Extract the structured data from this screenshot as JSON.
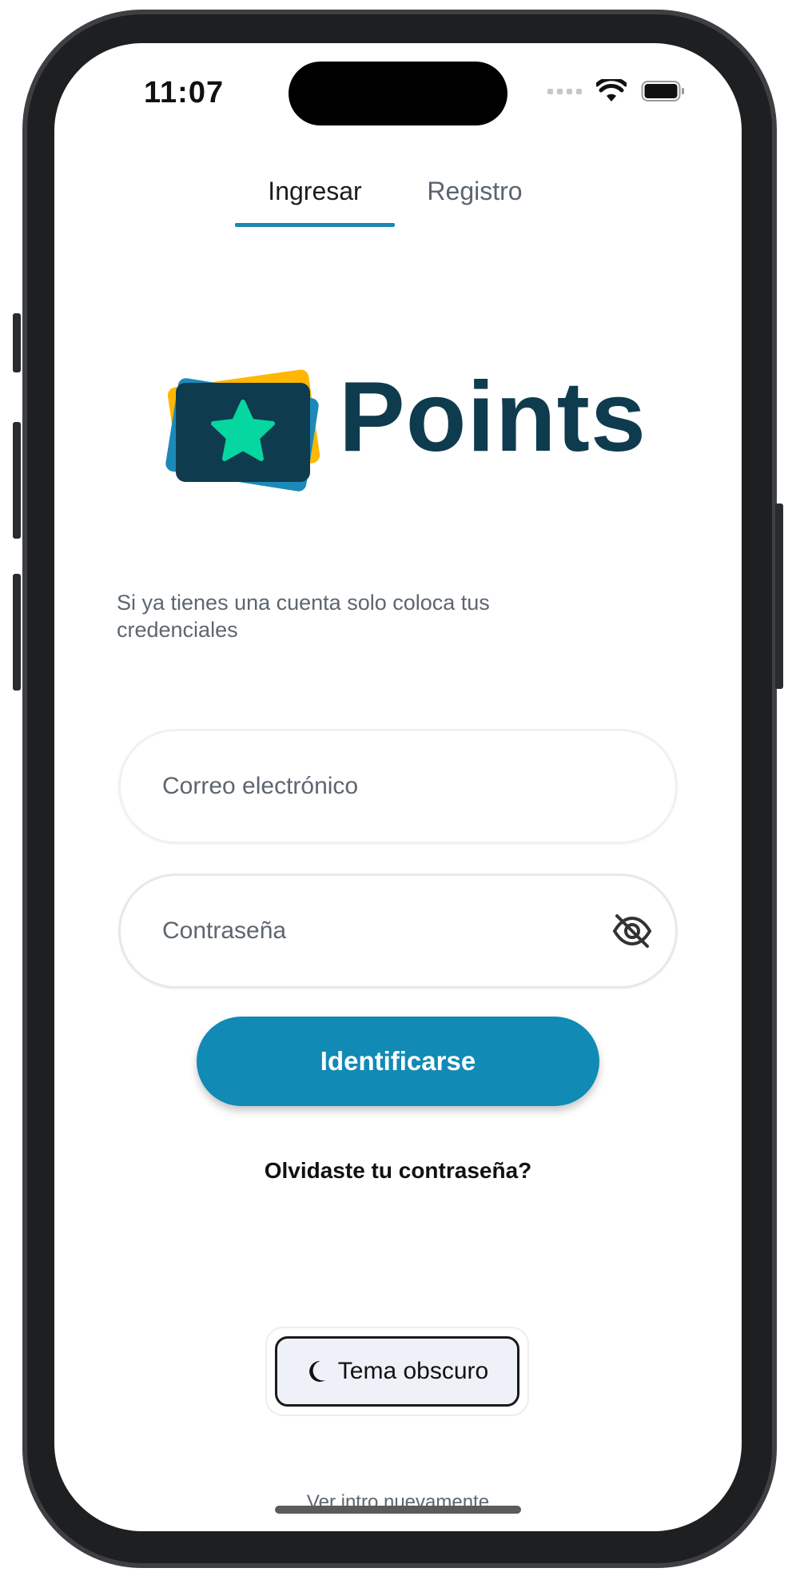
{
  "status_bar": {
    "time": "11:07",
    "icons": [
      "signal-icon",
      "wifi-icon",
      "battery-icon"
    ]
  },
  "tabs": [
    {
      "label": "Ingresar",
      "active": true
    },
    {
      "label": "Registro",
      "active": false
    }
  ],
  "logo": {
    "text": "Points",
    "icon": "star-card-logo-icon"
  },
  "intro_text": "Si ya tienes una cuenta solo coloca tus credenciales",
  "form": {
    "email_placeholder": "Correo electrónico",
    "email_value": "",
    "password_placeholder": "Contraseña",
    "password_value": "",
    "password_toggle_icon": "eye-off-icon",
    "submit_label": "Identificarse",
    "forgot_label": "Olvidaste tu contraseña?"
  },
  "theme_toggle": {
    "label": "Tema obscuro",
    "icon": "moon-icon"
  },
  "intro_link": "Ver intro nuevamente",
  "colors": {
    "accent": "#118ab5",
    "tab_indicator": "#1b87b5",
    "logo_dark": "#0f3b4e",
    "logo_star": "#06d6a0",
    "logo_yellow": "#ffb703",
    "logo_blue": "#1c8ab9"
  }
}
